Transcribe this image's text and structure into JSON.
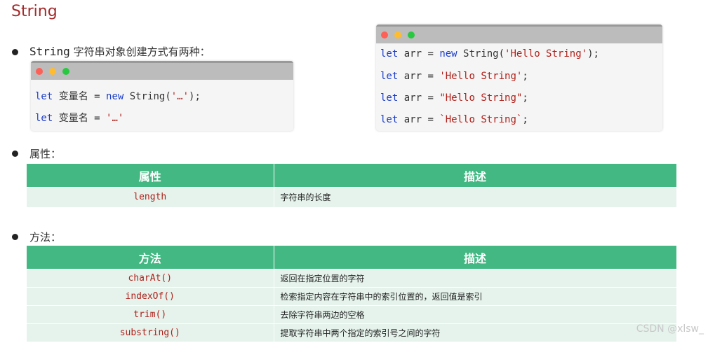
{
  "title": "String",
  "section1": {
    "label_code": "String",
    "label_text": " 字符串对象创建方式有两种："
  },
  "window_a": {
    "lines": [
      [
        {
          "t": "let",
          "c": "kw"
        },
        {
          "t": " 变量名 = ",
          "c": ""
        },
        {
          "t": "new",
          "c": "kw"
        },
        {
          "t": " String(",
          "c": ""
        },
        {
          "t": "'…'",
          "c": "str"
        },
        {
          "t": ");",
          "c": ""
        }
      ],
      [
        {
          "t": "let",
          "c": "kw"
        },
        {
          "t": " 变量名 = ",
          "c": ""
        },
        {
          "t": "'…'",
          "c": "str"
        }
      ]
    ]
  },
  "window_b": {
    "lines": [
      [
        {
          "t": "let",
          "c": "kw"
        },
        {
          "t": " arr = ",
          "c": ""
        },
        {
          "t": "new",
          "c": "kw"
        },
        {
          "t": " String(",
          "c": ""
        },
        {
          "t": "'Hello String'",
          "c": "str"
        },
        {
          "t": ");",
          "c": ""
        }
      ],
      [
        {
          "t": "let",
          "c": "kw"
        },
        {
          "t": " arr = ",
          "c": ""
        },
        {
          "t": "'Hello String'",
          "c": "str"
        },
        {
          "t": ";",
          "c": ""
        }
      ],
      [
        {
          "t": "let",
          "c": "kw"
        },
        {
          "t": " arr = ",
          "c": ""
        },
        {
          "t": "\"Hello String\"",
          "c": "str"
        },
        {
          "t": ";",
          "c": ""
        }
      ],
      [
        {
          "t": "let",
          "c": "kw"
        },
        {
          "t": " arr = ",
          "c": ""
        },
        {
          "t": "`Hello String`",
          "c": "str"
        },
        {
          "t": ";",
          "c": ""
        }
      ]
    ]
  },
  "section2": {
    "label": "属性：",
    "headers": [
      "属性",
      "描述"
    ],
    "rows": [
      {
        "name": "length",
        "desc": "字符串的长度"
      }
    ]
  },
  "section3": {
    "label": "方法：",
    "headers": [
      "方法",
      "描述"
    ],
    "rows": [
      {
        "name": "charAt()",
        "desc": "返回在指定位置的字符"
      },
      {
        "name": "indexOf()",
        "desc": "检索指定内容在字符串中的索引位置的，返回值是索引"
      },
      {
        "name": "trim()",
        "desc": "去除字符串两边的空格"
      },
      {
        "name": "substring()",
        "desc": "提取字符串中两个指定的索引号之间的字符"
      }
    ]
  },
  "watermark": "CSDN @xlsw_",
  "colors": {
    "title": "#a52a2a",
    "table_header": "#43b883",
    "table_row": "#e5f3ec",
    "keyword": "#1c3ec9",
    "string": "#b0201a",
    "dot_red": "#fe5f57",
    "dot_yellow": "#febc2e",
    "dot_green": "#28c840"
  }
}
